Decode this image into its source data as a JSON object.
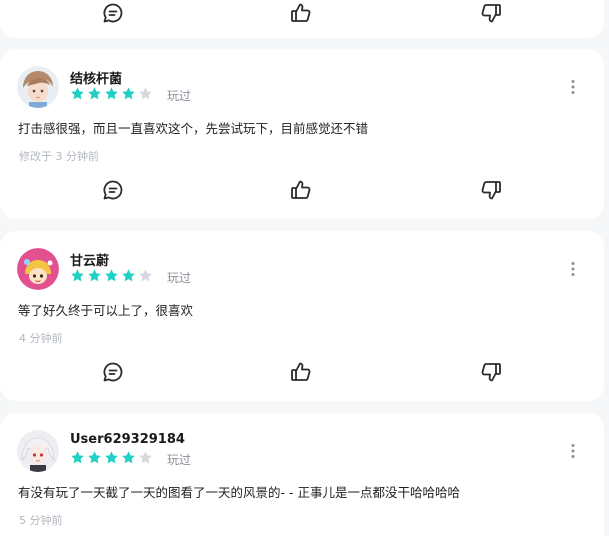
{
  "colors": {
    "star_active": "#21d0c4",
    "star_inactive": "#d6d9de",
    "icon": "#2b2b2b",
    "card": "#ffffff",
    "background": "#f5f7f9"
  },
  "reviews": [
    {
      "username": "结核杆菌",
      "rating": 4,
      "played_label": "玩过",
      "content": "打击感很强，而且一直喜欢这个，先尝试玩下，目前感觉还不错",
      "meta": "修改于 3 分钟前"
    },
    {
      "username": "甘云蔚",
      "rating": 4,
      "played_label": "玩过",
      "content": "等了好久终于可以上了，很喜欢",
      "meta": "4 分钟前"
    },
    {
      "username": "User629329184",
      "rating": 4,
      "played_label": "玩过",
      "content": "有没有玩了一天截了一天的图看了一天的风景的- - 正事儿是一点都没干哈哈哈哈",
      "meta": "5 分钟前"
    }
  ]
}
